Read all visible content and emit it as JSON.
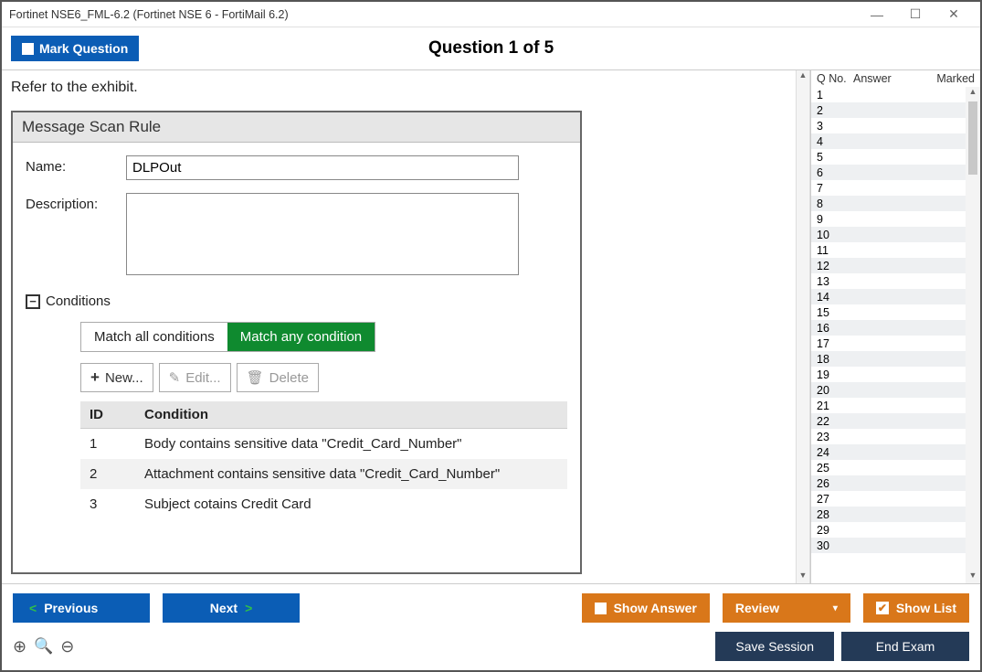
{
  "title": "Fortinet NSE6_FML-6.2 (Fortinet NSE 6 - FortiMail 6.2)",
  "header": {
    "mark_label": "Mark Question",
    "question_header": "Question 1 of 5"
  },
  "question": {
    "refer": "Refer to the exhibit."
  },
  "exhibit": {
    "panel_title": "Message Scan Rule",
    "name_label": "Name:",
    "name_value": "DLPOut",
    "desc_label": "Description:",
    "desc_value": "",
    "conditions_label": "Conditions",
    "tab_all": "Match all conditions",
    "tab_any": "Match any condition",
    "btn_new": "New...",
    "btn_edit": "Edit...",
    "btn_delete": "Delete",
    "col_id": "ID",
    "col_cond": "Condition",
    "rows": [
      {
        "id": "1",
        "cond": "Body contains sensitive data \"Credit_Card_Number\""
      },
      {
        "id": "2",
        "cond": "Attachment contains sensitive data \"Credit_Card_Number\""
      },
      {
        "id": "3",
        "cond": "Subject cotains Credit Card"
      }
    ]
  },
  "side": {
    "h1": "Q No.",
    "h2": "Answer",
    "h3": "Marked",
    "count": 30
  },
  "footer": {
    "prev": "Previous",
    "next": "Next",
    "show_answer": "Show Answer",
    "review": "Review",
    "show_list": "Show List",
    "save": "Save Session",
    "end": "End Exam"
  }
}
